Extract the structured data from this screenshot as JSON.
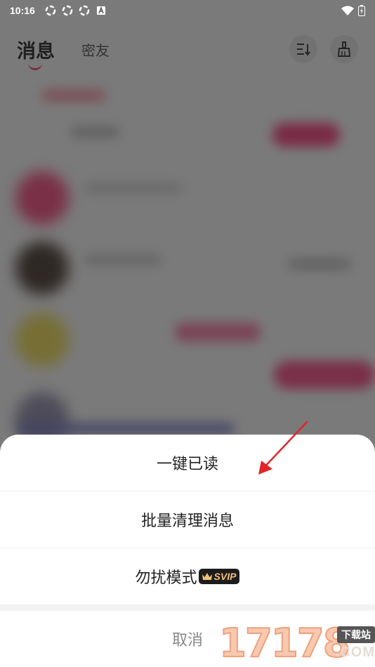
{
  "status_bar": {
    "time": "10:16",
    "notification_icons": [
      "sync-icon",
      "sync-icon",
      "sync-icon",
      "font-icon"
    ],
    "right_icons": [
      "wifi-icon",
      "battery-icon"
    ]
  },
  "header": {
    "active_tab": "消息",
    "inactive_tab": "密友",
    "accent_color": "#ff3b6b"
  },
  "sheet": {
    "items": [
      {
        "label": "一键已读"
      },
      {
        "label": "批量清理消息"
      },
      {
        "label": "勿扰模式",
        "badge": "SVIP"
      }
    ],
    "cancel_label": "取消"
  },
  "watermark": {
    "digits": "17178",
    "tag": "下载站",
    "domain": ".COM"
  }
}
